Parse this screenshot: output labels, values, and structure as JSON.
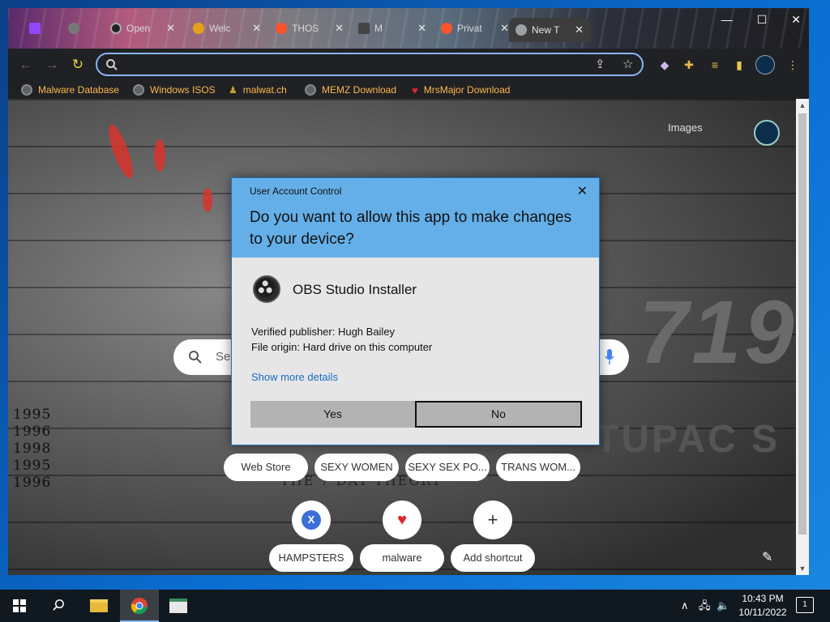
{
  "browser": {
    "tabs": [
      {
        "label": "",
        "favicon": "twitch-icon",
        "color": "#9146ff"
      },
      {
        "label": "",
        "favicon": "generic-icon",
        "color": "#777777"
      },
      {
        "label": "Open",
        "favicon": "obs-icon",
        "color": "#222222"
      },
      {
        "label": "Welc",
        "favicon": "welcome-icon",
        "color": "#e3a21a"
      },
      {
        "label": "THOS",
        "favicon": "brave-icon",
        "color": "#fb542b"
      },
      {
        "label": "M",
        "favicon": "page-icon",
        "color": "#444444"
      },
      {
        "label": "Privat",
        "favicon": "brave-icon",
        "color": "#fb542b"
      },
      {
        "label": "New T",
        "favicon": "chrome-icon",
        "color": "#9aa0a6"
      }
    ],
    "omnibox_value": "",
    "bookmarks": [
      {
        "label": "Malware Database",
        "icon": "globe-icon"
      },
      {
        "label": "Windows ISOS",
        "icon": "globe-icon"
      },
      {
        "label": "malwat.ch",
        "icon": "malwat-icon"
      },
      {
        "label": "MEMZ Download",
        "icon": "globe-icon"
      },
      {
        "label": "MrsMajor Download",
        "icon": "heart-icon"
      }
    ]
  },
  "newtab": {
    "images_link": "Images",
    "search_placeholder": "Se",
    "years": [
      "1995",
      "1996",
      "1998",
      "1995",
      "1996"
    ],
    "theory": "THE 7 DAY THEORY",
    "tupac": "TUPAC S",
    "number": "719",
    "chips": [
      "Web Store",
      "SEXY WOMEN",
      "SEXY SEX PO...",
      "TRANS WOM..."
    ],
    "shortcuts": [
      {
        "label": "HAMPSTERS",
        "icon": "x-icon"
      },
      {
        "label": "malware",
        "icon": "heart-icon"
      },
      {
        "label": "Add shortcut",
        "icon": "plus-icon"
      }
    ]
  },
  "uac": {
    "title": "User Account Control",
    "question": "Do you want to allow this app to make changes to your device?",
    "app_name": "OBS Studio Installer",
    "publisher": "Verified publisher: Hugh Bailey",
    "origin": "File origin: Hard drive on this computer",
    "more": "Show more details",
    "yes": "Yes",
    "no": "No"
  },
  "taskbar": {
    "time": "10:43 PM",
    "date": "10/11/2022",
    "notifications": "1"
  },
  "colors": {
    "accent": "#65afe8",
    "bookmark_text": "#ffb84d",
    "link": "#1a6cc4"
  }
}
